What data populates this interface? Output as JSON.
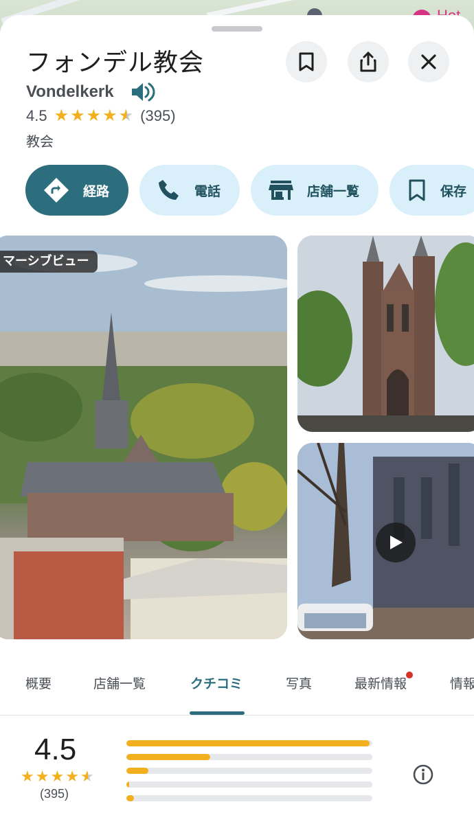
{
  "map": {
    "poi_label": "Hot"
  },
  "place": {
    "title": "フォンデル教会",
    "subtitle": "Vondelkerk",
    "rating": "4.5",
    "rating_value": 4.5,
    "review_count": "(395)",
    "category": "教会"
  },
  "header_buttons": {
    "save_icon": "bookmark-icon",
    "share_icon": "share-icon",
    "close_icon": "close-icon"
  },
  "actions": [
    {
      "label": "経路",
      "icon": "directions-icon"
    },
    {
      "label": "電話",
      "icon": "phone-icon"
    },
    {
      "label": "店舗一覧",
      "icon": "store-icon"
    },
    {
      "label": "保存",
      "icon": "bookmark-icon"
    }
  ],
  "photos": {
    "main_label": "マーシブビュー",
    "video_icon": "play-icon"
  },
  "tabs": [
    {
      "label": "概要",
      "active": false
    },
    {
      "label": "店舗一覧",
      "active": false
    },
    {
      "label": "クチコミ",
      "active": true
    },
    {
      "label": "写真",
      "active": false
    },
    {
      "label": "最新情報",
      "active": false,
      "badge": true
    },
    {
      "label": "情報",
      "active": false
    }
  ],
  "review_summary": {
    "rating": "4.5",
    "rating_value": 4.5,
    "count": "(395)",
    "distribution": [
      {
        "stars": 5,
        "fraction": 0.99
      },
      {
        "stars": 4,
        "fraction": 0.34
      },
      {
        "stars": 3,
        "fraction": 0.09
      },
      {
        "stars": 2,
        "fraction": 0.01
      },
      {
        "stars": 1,
        "fraction": 0.03
      }
    ]
  },
  "colors": {
    "accent": "#2c6e7d",
    "chip_bg": "#d9f0fb",
    "star": "#f2b01e",
    "badge": "#d93025"
  }
}
